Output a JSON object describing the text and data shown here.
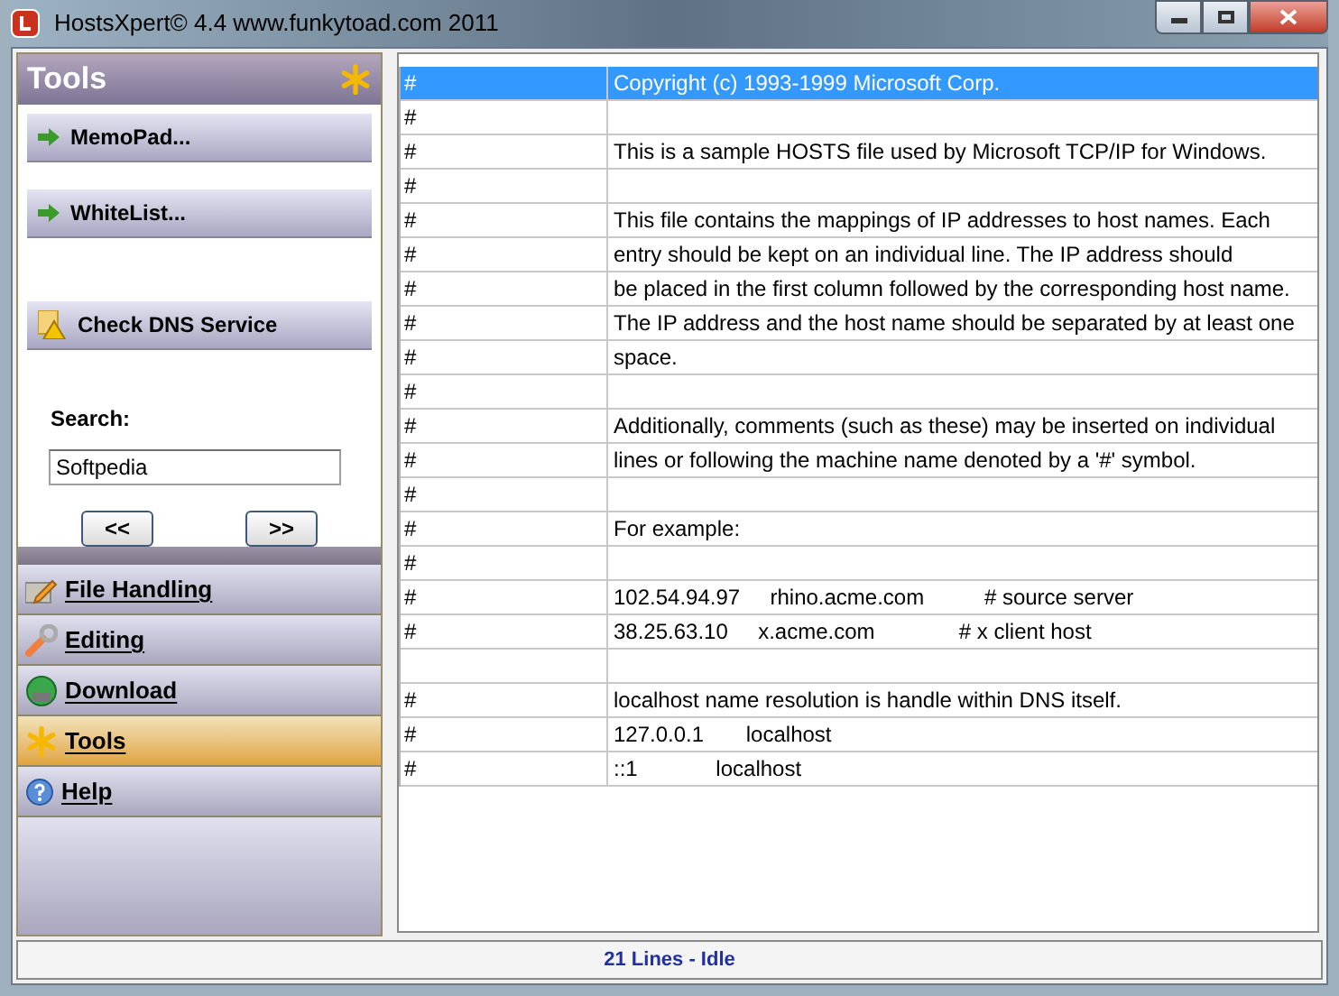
{
  "window": {
    "title": "HostsXpert© 4.4  www.funkytoad.com 2011"
  },
  "tools_panel": {
    "title": "Tools",
    "buttons": [
      {
        "label": "MemoPad...",
        "kind": "arrow"
      },
      {
        "label": "WhiteList...",
        "kind": "arrow"
      },
      {
        "label": "Check DNS Service",
        "kind": "dns"
      }
    ],
    "search": {
      "label": "Search:",
      "value": "Softpedia"
    },
    "nav_buttons": [
      "<<",
      ">>"
    ]
  },
  "nav": [
    {
      "label": "File Handling",
      "kind": "file",
      "selected": false
    },
    {
      "label": "Editing",
      "kind": "edit",
      "selected": false
    },
    {
      "label": "Download",
      "kind": "download",
      "selected": false
    },
    {
      "label": "Tools",
      "kind": "tools",
      "selected": true
    },
    {
      "label": "Help",
      "kind": "help",
      "selected": false
    }
  ],
  "table": {
    "rows": [
      {
        "column_1": "#",
        "column_2": "Copyright (c) 1993-1999 Microsoft Corp.",
        "selected": true
      },
      {
        "column_1": "#",
        "selected": false
      },
      {
        "column_1": "#",
        "column_2": "This is a sample HOSTS file used by Microsoft TCP/IP for Windows.",
        "selected": false
      },
      {
        "column_1": "#",
        "selected": false
      },
      {
        "column_1": "#",
        "column_2": "This file contains the mappings of IP addresses to host names. Each",
        "selected": false
      },
      {
        "column_1": "#",
        "column_2": "entry should be kept on an individual line. The IP address should",
        "selected": false
      },
      {
        "column_1": "#",
        "column_2": "be placed in the first column followed by the corresponding host name.",
        "selected": false
      },
      {
        "column_1": "#",
        "column_2": "The IP address and the host name should be separated by at least one",
        "selected": false
      },
      {
        "column_1": "#",
        "column_2": "space.",
        "selected": false
      },
      {
        "column_1": "#",
        "selected": false
      },
      {
        "column_1": "#",
        "column_2": "Additionally, comments (such as these) may be inserted on individual",
        "selected": false
      },
      {
        "column_1": "#",
        "column_2": "lines or following the machine name denoted by a '#' symbol.",
        "selected": false
      },
      {
        "column_1": "#",
        "selected": false
      },
      {
        "column_1": "#",
        "column_2": "For example:",
        "selected": false
      },
      {
        "column_1": "#",
        "selected": false
      },
      {
        "column_1": "#",
        "column_2": "102.54.94.97     rhino.acme.com          # source server",
        "selected": false
      },
      {
        "column_1": "#",
        "column_2": "38.25.63.10     x.acme.com              # x client host",
        "selected": false
      },
      {
        "selected": false
      },
      {
        "column_1": "#",
        "column_2": "localhost name resolution is handle within DNS itself.",
        "selected": false
      },
      {
        "column_1": "#",
        "column_2": "127.0.0.1       localhost",
        "selected": false
      },
      {
        "column_1": "#",
        "column_2": "::1             localhost",
        "selected": false
      }
    ]
  },
  "status_bar": "21 Lines - Idle"
}
